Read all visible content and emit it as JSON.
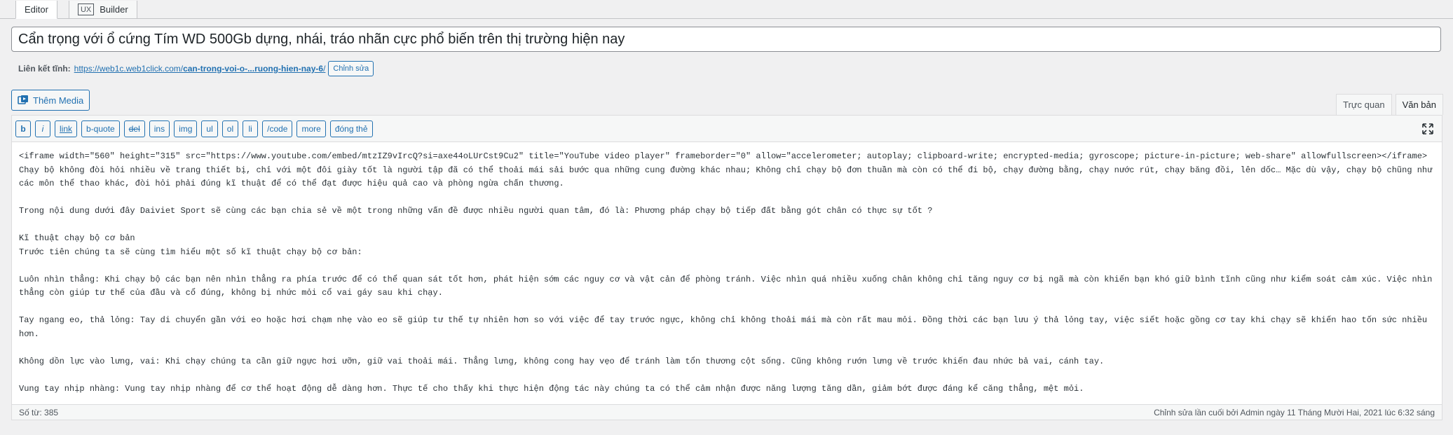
{
  "tabs": {
    "editor": "Editor",
    "ux_badge": "UX",
    "builder": "Builder"
  },
  "post_title": "Cẩn trọng với ổ cứng Tím WD 500Gb dựng, nhái, tráo nhãn cực phổ biến trên thị trường hiện nay",
  "permalink": {
    "label": "Liên kết tĩnh:",
    "url_prefix": "https://web1c.web1click.com/",
    "url_slug": "can-trong-voi-o-...ruong-hien-nay-6",
    "url_suffix": "/",
    "edit_label": "Chỉnh sửa"
  },
  "add_media_label": "Thêm Media",
  "mode_tabs": {
    "visual": "Trực quan",
    "text": "Văn bản"
  },
  "toolbar": [
    "b",
    "i",
    "link",
    "b-quote",
    "del",
    "ins",
    "img",
    "ul",
    "ol",
    "li",
    "/code",
    "more",
    "đóng thẻ"
  ],
  "content_lines": [
    "<iframe width=\"560\" height=\"315\" src=\"https://www.youtube.com/embed/mtzIZ9vIrcQ?si=axe44oLUrCst9Cu2\" title=\"YouTube video player\" frameborder=\"0\" allow=\"accelerometer; autoplay; clipboard-write; encrypted-media; gyroscope; picture-in-picture; web-share\" allowfullscreen></iframe>",
    "Chạy bộ không đòi hỏi nhiều về trang thiết bị, chỉ với một đôi giày tốt là người tập đã có thể thoải mái sải bước qua những cung đường khác nhau; Không chỉ chạy bộ đơn thuần mà còn có thể đi bộ, chạy đường bằng, chạy nước rút, chạy băng đồi, lên dốc… Mặc dù vậy, chạy bộ chũng như các môn thể thao khác, đòi hỏi phải đúng kĩ thuật để có thể đạt được hiệu quả cao và phòng ngừa chấn thương.",
    "",
    "Trong nội dung dưới đây Daiviet Sport sẽ cùng các bạn chia sẻ về một trong những vấn đề được nhiều người quan tâm, đó là: Phương pháp chạy bộ tiếp đất bằng gót chân có thực sự tốt ?",
    "",
    "Kĩ thuật chạy bộ cơ bản",
    "Trước tiên chúng ta sẽ cùng tìm hiểu một số kĩ thuật chạy bộ cơ bản:",
    "",
    "Luôn nhìn thẳng: Khi chạy bộ các bạn nên nhìn thẳng ra phía trước để có thể quan sát tốt hơn, phát hiện sớm các nguy cơ và vật cản để phòng tránh. Việc nhìn quá nhiều xuống chân không chỉ tăng nguy cơ bị ngã mà còn khiến bạn khó giữ bình tĩnh cũng như kiểm soát cảm xúc. Việc nhìn thẳng còn giúp tư thế của đầu và cổ đúng, không bị nhức mỏi cổ vai gáy sau khi chạy.",
    "",
    "Tay ngang eo, thả lỏng: Tay di chuyển gần với eo hoặc hơi chạm nhẹ vào eo sẽ giúp tư thế tự nhiên hơn so với việc để tay trước ngực, không chỉ không thoải mái mà còn rất mau mỏi. Đồng thời các bạn lưu ý thả lỏng tay, việc siết hoặc gồng cơ tay khi chạy sẽ khiến hao tốn sức nhiều hơn.",
    "",
    "Không dồn lực vào lưng, vai: Khi chạy chúng ta cần giữ ngực hơi ưỡn, giữ vai thoải mái. Thẳng lưng, không cong hay vẹo để tránh làm tổn thương cột sống. Cũng không rướn lưng về trước khiến đau nhức bả vai, cánh tay.",
    "",
    "Vung tay nhịp nhàng: Vung tay nhịp nhàng để cơ thể hoạt động dễ dàng hơn. Thực tế cho thấy khi thực hiện động tác này chúng ta có thể cảm nhận được năng lượng tăng dần, giảm bớt được đáng kể căng thẳng, mệt mỏi."
  ],
  "status": {
    "word_count": "Số từ: 385",
    "last_edit": "Chỉnh sửa lần cuối bởi Admin ngày 11 Tháng Mười Hai, 2021 lúc 6:32 sáng"
  }
}
